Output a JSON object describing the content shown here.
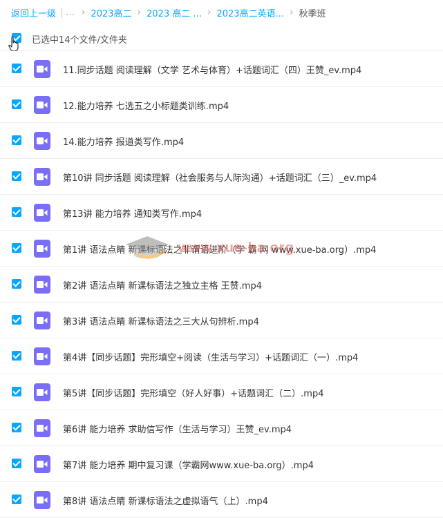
{
  "breadcrumb": {
    "back": "返回上一级",
    "ellipsis": "...",
    "items": [
      "2023高二",
      "2023 高二 ...",
      "2023高二英语..."
    ],
    "current": "秋季班"
  },
  "selection": {
    "text": "已选中14个文件/文件夹",
    "all_checked": true
  },
  "files": [
    {
      "name": "11.同步话题 阅读理解（文学 艺术与体育）+话题词汇（四）王赞_ev.mp4",
      "checked": true,
      "icon": "video-file-icon"
    },
    {
      "name": "12.能力培养 七选五之小标题类训练.mp4",
      "checked": true,
      "icon": "video-file-icon"
    },
    {
      "name": "14.能力培养 报道类写作.mp4",
      "checked": true,
      "icon": "video-file-icon"
    },
    {
      "name": "第10讲 同步话题 阅读理解（社会服务与人际沟通）+话题词汇（三）_ev.mp4",
      "checked": true,
      "icon": "video-file-icon"
    },
    {
      "name": "第13讲 能力培养 通知类写作.mp4",
      "checked": true,
      "icon": "video-file-icon"
    },
    {
      "name": "第1讲 语法点睛 新课标语法之非谓语进阶（学 霸 网 www.xue-ba.org）.mp4",
      "checked": true,
      "icon": "video-file-icon"
    },
    {
      "name": "第2讲 语法点睛 新课标语法之独立主格 王赞.mp4",
      "checked": true,
      "icon": "video-file-icon"
    },
    {
      "name": "第3讲 语法点睛 新课标语法之三大从句辨析.mp4",
      "checked": true,
      "icon": "video-file-icon"
    },
    {
      "name": "第4讲【同步话题】完形填空+阅读（生活与学习）+话题词汇（一）.mp4",
      "checked": true,
      "icon": "video-file-icon"
    },
    {
      "name": "第5讲【同步话题】完形填空（好人好事）+话题词汇（二）.mp4",
      "checked": true,
      "icon": "video-file-icon"
    },
    {
      "name": "第6讲 能力培养 求助信写作（生活与学习）王赞_ev.mp4",
      "checked": true,
      "icon": "video-file-icon"
    },
    {
      "name": "第7讲 能力培养 期中复习课（学霸网www.xue-ba.org）.mp4",
      "checked": true,
      "icon": "video-file-icon"
    },
    {
      "name": "第8讲 语法点睛 新课标语法之虚拟语气（上）.mp4",
      "checked": true,
      "icon": "video-file-icon"
    }
  ],
  "watermark": {
    "text": "www.xue-ba.org"
  },
  "colors": {
    "accent": "#06a7ff",
    "video_icon": "#7b6ef6",
    "row_border": "#eef0f4"
  }
}
